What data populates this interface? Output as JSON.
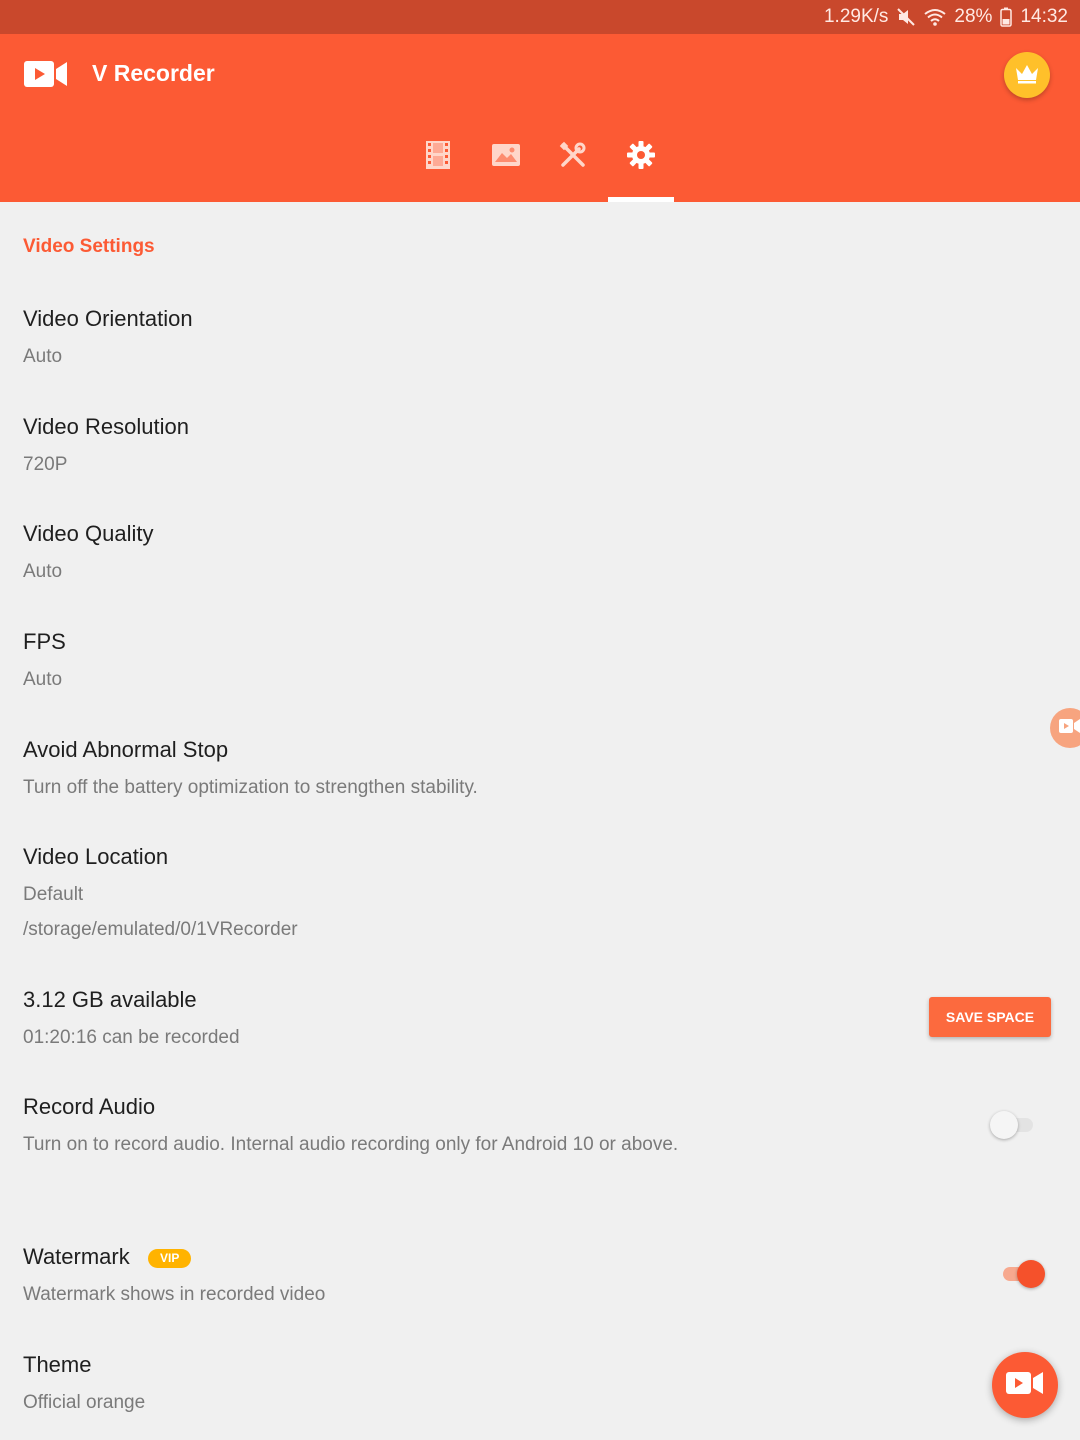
{
  "status_bar": {
    "net_speed": "1.29K/s",
    "battery": "28%",
    "time": "14:32"
  },
  "app_bar": {
    "title": "V Recorder",
    "tabs": [
      {
        "icon": "film-icon",
        "selected": false
      },
      {
        "icon": "image-icon",
        "selected": false
      },
      {
        "icon": "tools-icon",
        "selected": false
      },
      {
        "icon": "gear-icon",
        "selected": true
      }
    ],
    "accent_color": "#fc5a34"
  },
  "settings": {
    "section_header": "Video Settings",
    "orientation": {
      "title": "Video Orientation",
      "value": "Auto"
    },
    "resolution": {
      "title": "Video Resolution",
      "value": "720P"
    },
    "quality": {
      "title": "Video Quality",
      "value": "Auto"
    },
    "fps": {
      "title": "FPS",
      "value": "Auto"
    },
    "abnormal_stop": {
      "title": "Avoid Abnormal Stop",
      "desc": "Turn off the battery optimization to strengthen stability."
    },
    "location": {
      "title": "Video Location",
      "value": "Default",
      "path": "/storage/emulated/0/1VRecorder"
    },
    "storage": {
      "title": "3.12 GB available",
      "desc": "01:20:16 can be recorded",
      "button": "SAVE SPACE"
    },
    "record_audio": {
      "title": "Record Audio",
      "desc": "Turn on to record audio. Internal audio recording only for Android 10 or above.",
      "enabled": false
    },
    "watermark": {
      "title": "Watermark",
      "badge": "VIP",
      "desc": "Watermark shows in recorded video",
      "enabled": true
    },
    "theme": {
      "title": "Theme",
      "value": "Official orange"
    }
  }
}
